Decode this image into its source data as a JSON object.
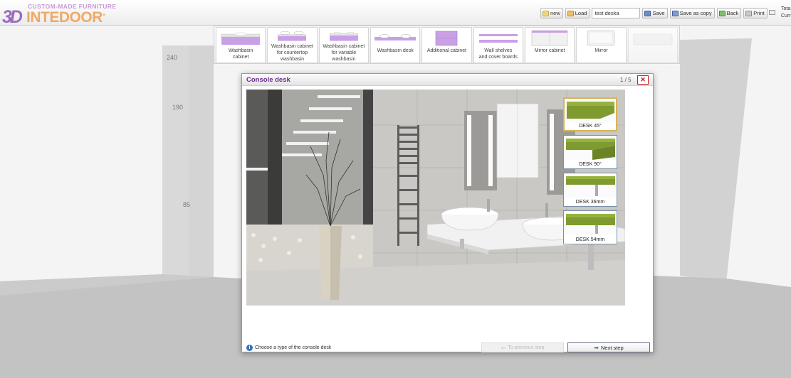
{
  "header": {
    "logo_tagline": "CUSTOM-MADE FURNITURE",
    "logo_3d": "3D",
    "logo_brand": "INTEDOOR",
    "logo_reg": "®"
  },
  "toolbar": {
    "new_label": "new",
    "load_label": "Load",
    "project_name": "test deska",
    "save_label": "Save",
    "save_copy_label": "Save as copy",
    "back_label": "Back",
    "print_label": "Print",
    "cut_text_1": "Tota",
    "cut_text_2": "Curr"
  },
  "room": {
    "dims": [
      "240",
      "190",
      "85"
    ]
  },
  "categories": [
    {
      "label": "Washbasin\ncabinet",
      "icon": "washbasin-cabinet-icon"
    },
    {
      "label": "Washbasin cabinet\nfor countertop washbasin",
      "icon": "countertop-cabinet-icon"
    },
    {
      "label": "Washbasin cabinet\nfor variable washbasin",
      "icon": "variable-cabinet-icon"
    },
    {
      "label": "Washbasin desk",
      "icon": "washbasin-desk-icon"
    },
    {
      "label": "Additional cabinet",
      "icon": "additional-cabinet-icon"
    },
    {
      "label": "Wall shelves\nand cover boards",
      "icon": "wall-shelves-icon"
    },
    {
      "label": "Mirror cabinet",
      "icon": "mirror-cabinet-icon"
    },
    {
      "label": "Mirror",
      "icon": "mirror-icon"
    },
    {
      "label": "",
      "icon": "bathtub-icon"
    }
  ],
  "modal": {
    "title": "Console desk",
    "pager": "1 / 5",
    "close": "✕",
    "hint": "Choose a type of the console desk",
    "prev_label": "To previous step",
    "next_label": "Next step",
    "options": [
      {
        "label": "DESK 45°",
        "selected": true
      },
      {
        "label": "DESK 90°",
        "selected": false
      },
      {
        "label": "DESK 36mm",
        "selected": false
      },
      {
        "label": "DESK 54mm",
        "selected": false
      }
    ]
  },
  "colors": {
    "accent_purple": "#6a2c91",
    "desk_green": "#7f9a2e",
    "selection_gold": "#d7b45a"
  }
}
